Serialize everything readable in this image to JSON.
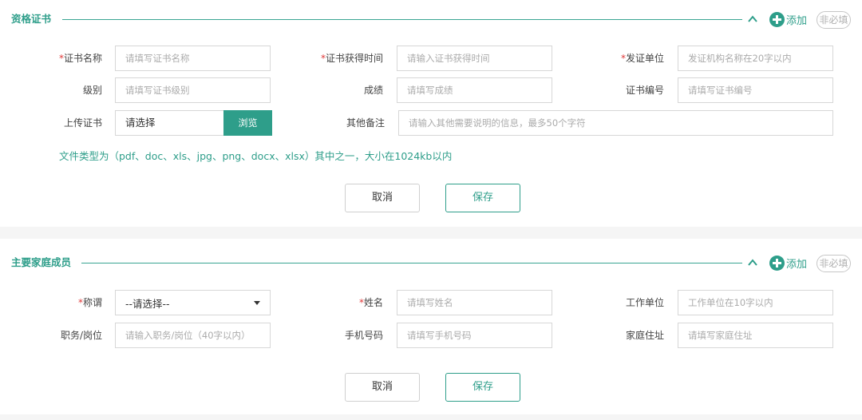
{
  "certificates": {
    "title": "资格证书",
    "add_label": "添加",
    "optional_label": "非必填",
    "fields": {
      "cert_name": {
        "label": "证书名称",
        "required": "*",
        "placeholder": "请填写证书名称"
      },
      "cert_time": {
        "label": "证书获得时间",
        "required": "*",
        "placeholder": "请输入证书获得时间"
      },
      "issuer": {
        "label": "发证单位",
        "required": "*",
        "placeholder": "发证机构名称在20字以内"
      },
      "level": {
        "label": "级别",
        "placeholder": "请填写证书级别"
      },
      "score": {
        "label": "成绩",
        "placeholder": "请填写成绩"
      },
      "cert_no": {
        "label": "证书编号",
        "placeholder": "请填写证书编号"
      },
      "upload": {
        "label": "上传证书",
        "value": "请选择",
        "browse_label": "浏览"
      },
      "remarks": {
        "label": "其他备注",
        "placeholder": "请输入其他需要说明的信息，最多50个字符"
      }
    },
    "file_hint": "文件类型为（pdf、doc、xls、jpg、png、docx、xlsx）其中之一，大小在1024kb以内",
    "cancel_label": "取消",
    "save_label": "保存"
  },
  "family": {
    "title": "主要家庭成员",
    "add_label": "添加",
    "optional_label": "非必填",
    "fields": {
      "relation": {
        "label": "称谓",
        "required": "*",
        "value": "--请选择--"
      },
      "name": {
        "label": "姓名",
        "required": "*",
        "placeholder": "请填写姓名"
      },
      "employer": {
        "label": "工作单位",
        "placeholder": "工作单位在10字以内"
      },
      "position": {
        "label": "职务/岗位",
        "placeholder": "请输入职务/岗位（40字以内）"
      },
      "phone": {
        "label": "手机号码",
        "placeholder": "请填写手机号码"
      },
      "address": {
        "label": "家庭住址",
        "placeholder": "请填写家庭住址"
      }
    },
    "cancel_label": "取消",
    "save_label": "保存"
  },
  "colors": {
    "accent": "#2e9e8a",
    "required": "#e03a3a",
    "border": "#d7d7d7"
  },
  "icons": {
    "collapse": "chevron-up-icon",
    "add": "plus-circle-icon",
    "select": "caret-down-icon"
  }
}
